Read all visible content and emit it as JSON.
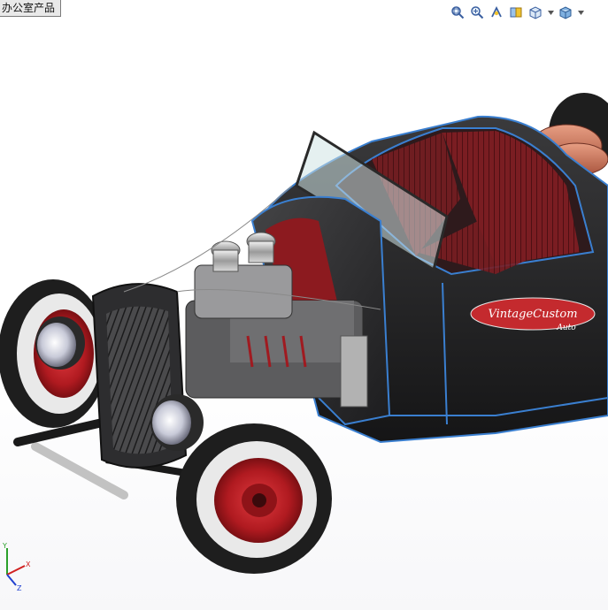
{
  "window": {
    "title_tag": "办公室产品"
  },
  "hud_toolbar": {
    "buttons": [
      {
        "icon": "zoom-to-fit-icon"
      },
      {
        "icon": "zoom-to-area-icon"
      },
      {
        "icon": "previous-view-icon"
      },
      {
        "icon": "section-view-icon"
      },
      {
        "icon": "view-orientation-icon"
      },
      {
        "icon": "display-style-icon"
      }
    ]
  },
  "model": {
    "badge_text": "VintageCustom",
    "badge_subtext": "Auto",
    "body_color": "#2b2b2d",
    "edge_color": "#3a7fd0",
    "interior_color": "#7a1d22",
    "wheel_color": "#c41e24",
    "tire_color": "#1e1e1e",
    "whitewall_color": "#e9e9e9"
  },
  "triad": {
    "x_label": "X",
    "y_label": "Y",
    "z_label": "Z"
  }
}
